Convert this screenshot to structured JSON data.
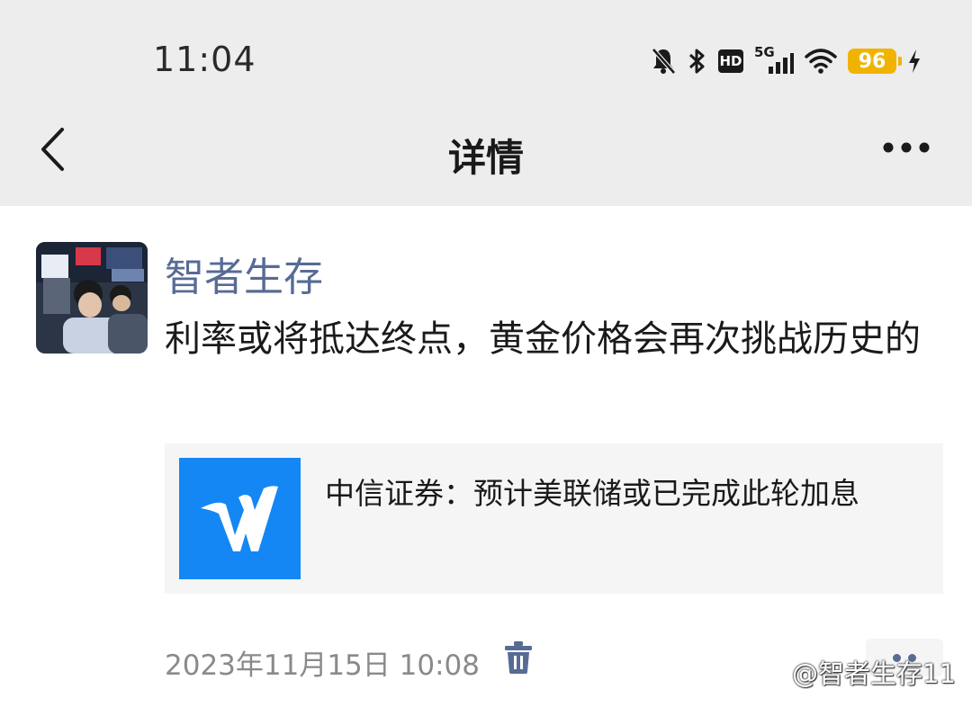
{
  "status_bar": {
    "time": "11:04",
    "network": "5G",
    "hd_label": "HD",
    "battery_level": "96",
    "icons": [
      "mute-bell-icon",
      "bluetooth-icon",
      "hd-icon",
      "signal-5g-icon",
      "wifi-icon",
      "battery-icon",
      "charging-icon"
    ]
  },
  "nav": {
    "title": "详情",
    "back_icon": "chevron-left-icon",
    "more_icon": "more-horizontal-icon"
  },
  "post": {
    "author": "智者生存",
    "text": "利率或将抵达终点，黄金价格会再次挑战历史的",
    "link": {
      "title": "中信证券：预计美联储或已完成此轮加息",
      "thumb_color": "#1487f5"
    },
    "timestamp": "2023年11月15日 10:08"
  },
  "watermark": "@智者生存11",
  "colors": {
    "author": "#576b95",
    "background": "#ededed",
    "link_card": "#f5f5f5"
  }
}
